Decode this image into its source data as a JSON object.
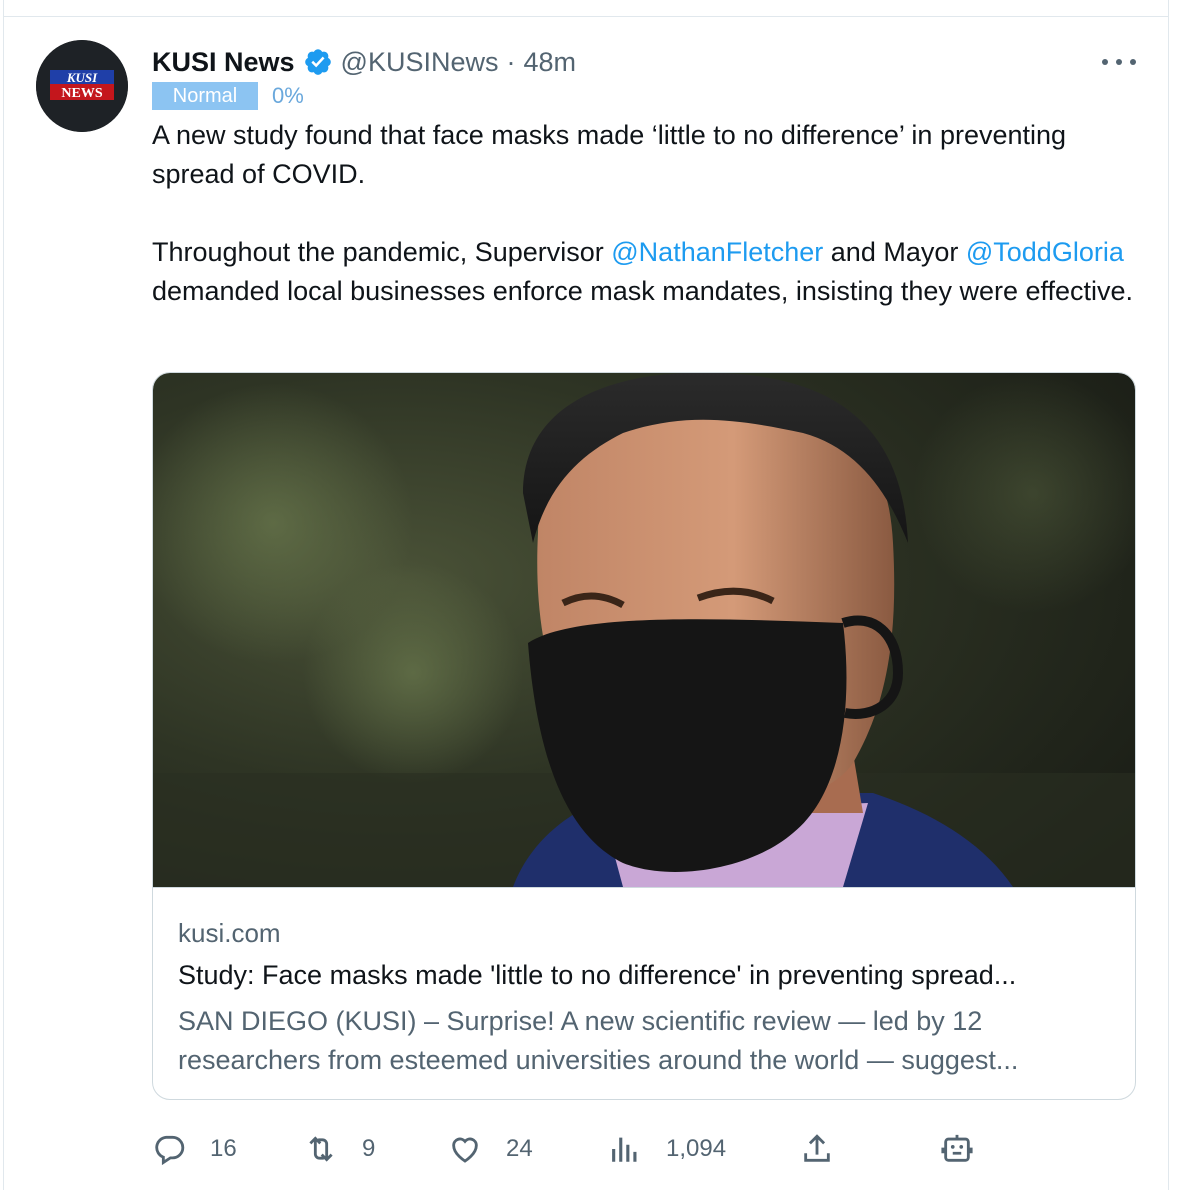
{
  "tweet": {
    "author_name": "KUSI News",
    "handle": "@KUSINews",
    "separator": "·",
    "time": "48m",
    "avatar_logo_text": [
      "KUSI",
      "NEWS"
    ],
    "status_badge": "Normal",
    "status_percent": "0%",
    "text": {
      "p1": "A new study found that face masks made ‘little to no difference’ in preventing spread of COVID.",
      "p2_a": "Throughout the pandemic, Supervisor ",
      "p2_mention1": "@NathanFletcher",
      "p2_b": " and Mayor ",
      "p2_mention2": "@ToddGloria",
      "p2_c": " demanded local businesses enforce mask mandates, insisting they were effective."
    },
    "card": {
      "domain": "kusi.com",
      "title": "Study: Face masks made 'little to no difference' in preventing spread...",
      "description": "SAN DIEGO (KUSI) – Surprise! A new scientific review — led by 12 researchers from esteemed universities around the world — suggest..."
    },
    "actions": {
      "replies": "16",
      "retweets": "9",
      "likes": "24",
      "views": "1,094"
    }
  },
  "colors": {
    "accent": "#1d9bf0",
    "muted": "#536471",
    "badge": "#8cc4f2",
    "border": "#cfd9de"
  },
  "icons": [
    "verified-badge-icon",
    "more-options-icon",
    "reply-icon",
    "retweet-icon",
    "like-icon",
    "views-icon",
    "share-icon",
    "robot-icon"
  ]
}
